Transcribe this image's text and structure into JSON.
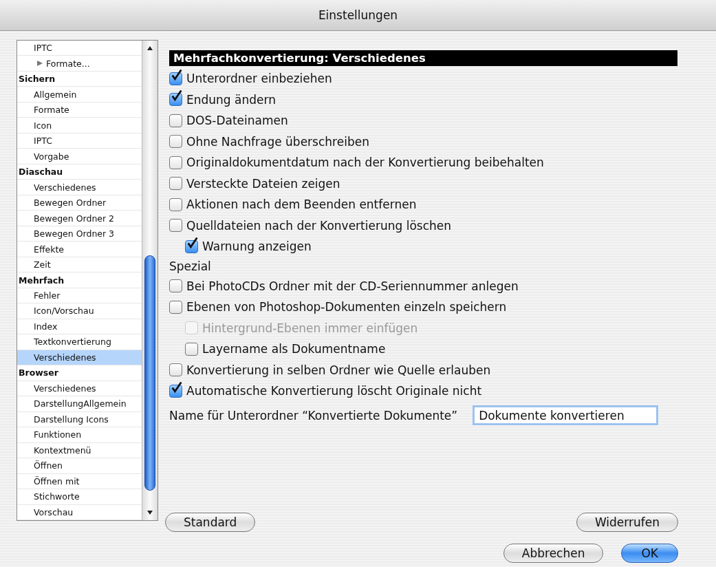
{
  "window": {
    "title": "Einstellungen"
  },
  "sidebar": {
    "items": [
      {
        "label": "IPTC",
        "kind": "item",
        "selected": false
      },
      {
        "label": "Formate...",
        "kind": "group",
        "selected": false
      },
      {
        "label": "Sichern",
        "kind": "header",
        "selected": false
      },
      {
        "label": "Allgemein",
        "kind": "item",
        "selected": false
      },
      {
        "label": "Formate",
        "kind": "item",
        "selected": false
      },
      {
        "label": "Icon",
        "kind": "item",
        "selected": false
      },
      {
        "label": "IPTC",
        "kind": "item",
        "selected": false
      },
      {
        "label": "Vorgabe",
        "kind": "item",
        "selected": false
      },
      {
        "label": "Diaschau",
        "kind": "header",
        "selected": false
      },
      {
        "label": "Verschiedenes",
        "kind": "item",
        "selected": false
      },
      {
        "label": "Bewegen Ordner",
        "kind": "item",
        "selected": false
      },
      {
        "label": "Bewegen Ordner 2",
        "kind": "item",
        "selected": false
      },
      {
        "label": "Bewegen Ordner 3",
        "kind": "item",
        "selected": false
      },
      {
        "label": "Effekte",
        "kind": "item",
        "selected": false
      },
      {
        "label": "Zeit",
        "kind": "item",
        "selected": false
      },
      {
        "label": "Mehrfach",
        "kind": "header",
        "selected": false
      },
      {
        "label": "Fehler",
        "kind": "item",
        "selected": false
      },
      {
        "label": "Icon/Vorschau",
        "kind": "item",
        "selected": false
      },
      {
        "label": "Index",
        "kind": "item",
        "selected": false
      },
      {
        "label": "Textkonvertierung",
        "kind": "item",
        "selected": false
      },
      {
        "label": "Verschiedenes",
        "kind": "item",
        "selected": true
      },
      {
        "label": "Browser",
        "kind": "header",
        "selected": false
      },
      {
        "label": "Verschiedenes",
        "kind": "item",
        "selected": false
      },
      {
        "label": "DarstellungAllgemein",
        "kind": "item",
        "selected": false
      },
      {
        "label": "Darstellung Icons",
        "kind": "item",
        "selected": false
      },
      {
        "label": "Funktionen",
        "kind": "item",
        "selected": false
      },
      {
        "label": "Kontextmenü",
        "kind": "item",
        "selected": false
      },
      {
        "label": "Öffnen",
        "kind": "item",
        "selected": false
      },
      {
        "label": "Öffnen mit",
        "kind": "item",
        "selected": false
      },
      {
        "label": "Stichworte",
        "kind": "item",
        "selected": false
      },
      {
        "label": "Vorschau",
        "kind": "item",
        "selected": false
      }
    ]
  },
  "panel": {
    "title": "Mehrfachkonvertierung: Verschiedenes",
    "options": [
      {
        "kind": "checkbox",
        "label": "Unterordner einbeziehen",
        "checked": true,
        "disabled": false
      },
      {
        "kind": "checkbox",
        "label": "Endung ändern",
        "checked": true,
        "disabled": false
      },
      {
        "kind": "checkbox",
        "label": "DOS-Dateinamen",
        "checked": false,
        "disabled": false
      },
      {
        "kind": "checkbox",
        "label": "Ohne Nachfrage überschreiben",
        "checked": false,
        "disabled": false
      },
      {
        "kind": "checkbox",
        "label": "Originaldokumentdatum nach der Konvertierung beibehalten",
        "checked": false,
        "disabled": false
      },
      {
        "kind": "checkbox",
        "label": "Versteckte Dateien zeigen",
        "checked": false,
        "disabled": false
      },
      {
        "kind": "checkbox",
        "label": "Aktionen nach dem Beenden entfernen",
        "checked": false,
        "disabled": false
      },
      {
        "kind": "checkbox",
        "label": "Quelldateien nach der Konvertierung löschen",
        "checked": false,
        "disabled": false,
        "children": [
          {
            "kind": "checkbox",
            "label": "Warnung anzeigen",
            "checked": true,
            "disabled": false
          }
        ]
      },
      {
        "kind": "heading",
        "label": "Spezial"
      },
      {
        "kind": "checkbox",
        "label": "Bei PhotoCDs Ordner mit der CD-Seriennummer anlegen",
        "checked": false,
        "disabled": false
      },
      {
        "kind": "checkbox",
        "label": "Ebenen von Photoshop-Dokumenten einzeln speichern",
        "checked": false,
        "disabled": false,
        "children": [
          {
            "kind": "checkbox",
            "label": "Hintergrund-Ebenen immer einfügen",
            "checked": false,
            "disabled": true
          },
          {
            "kind": "checkbox",
            "label": "Layername als Dokumentname",
            "checked": false,
            "disabled": false
          }
        ]
      },
      {
        "kind": "checkbox",
        "label": "Konvertierung in selben Ordner wie Quelle erlauben",
        "checked": false,
        "disabled": false
      },
      {
        "kind": "checkbox",
        "label": "Automatische Konvertierung löscht Originale nicht",
        "checked": true,
        "disabled": false
      },
      {
        "kind": "field",
        "label": "Name für Unterordner “Konvertierte Dokumente”",
        "value": "Dokumente konvertieren"
      }
    ]
  },
  "buttons": [
    {
      "label": "Standard",
      "default": false
    },
    {
      "label": "Widerrufen",
      "default": false
    },
    {
      "label": "Abbrechen",
      "default": false
    },
    {
      "label": "OK",
      "default": true
    }
  ]
}
